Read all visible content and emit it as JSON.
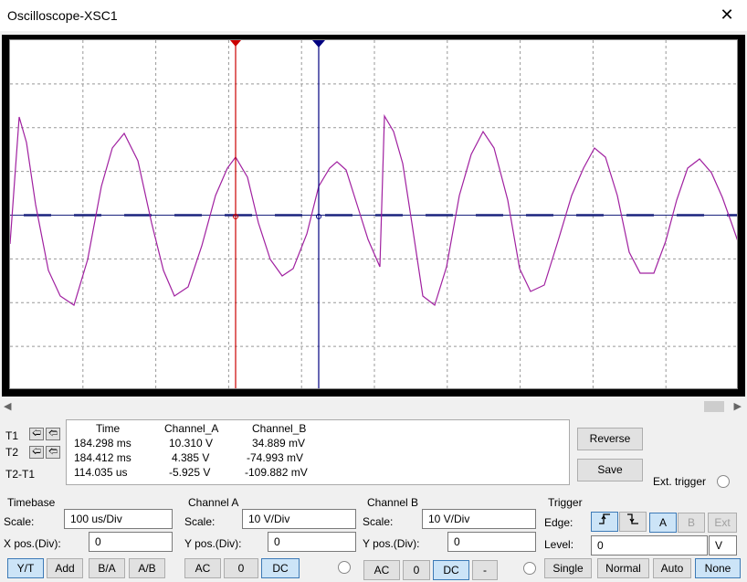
{
  "window": {
    "title": "Oscilloscope-XSC1",
    "close_glyph": "✕"
  },
  "screen": {
    "grid": true,
    "background": "#ffffff",
    "trace_color": "#a020a0",
    "t1_color": "#cc0000",
    "t2_color": "#000080"
  },
  "cursors": {
    "t1_label": "T1",
    "t2_label": "T2",
    "diff_label": "T2-T1"
  },
  "readout": {
    "headers": [
      "Time",
      "Channel_A",
      "Channel_B"
    ],
    "rows": [
      [
        "184.298 ms",
        "10.310 V",
        "34.889 mV"
      ],
      [
        "184.412 ms",
        "4.385 V",
        "-74.993 mV"
      ],
      [
        "114.035 us",
        "-5.925 V",
        "-109.882 mV"
      ]
    ]
  },
  "actions": {
    "reverse": "Reverse",
    "save": "Save",
    "ext_trigger": "Ext. trigger"
  },
  "timebase": {
    "title": "Timebase",
    "scale_label": "Scale:",
    "scale_value": "100 us/Div",
    "xpos_label": "X pos.(Div):",
    "xpos_value": "0",
    "modes": [
      "Y/T",
      "Add",
      "B/A",
      "A/B"
    ]
  },
  "channel_a": {
    "title": "Channel A",
    "scale_label": "Scale:",
    "scale_value": "10  V/Div",
    "ypos_label": "Y pos.(Div):",
    "ypos_value": "0",
    "coupling": [
      "AC",
      "0",
      "DC"
    ]
  },
  "channel_b": {
    "title": "Channel B",
    "scale_label": "Scale:",
    "scale_value": "10  V/Div",
    "ypos_label": "Y pos.(Div):",
    "ypos_value": "0",
    "coupling": [
      "AC",
      "0",
      "DC",
      "-"
    ]
  },
  "trigger": {
    "title": "Trigger",
    "edge_label": "Edge:",
    "sources": [
      "A",
      "B",
      "Ext"
    ],
    "level_label": "Level:",
    "level_value": "0",
    "level_unit": "V",
    "modes": [
      "Single",
      "Normal",
      "Auto",
      "None"
    ]
  }
}
